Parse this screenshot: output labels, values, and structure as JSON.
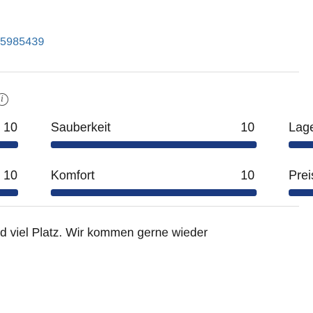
{
  "header": {
    "id_text": "5985439"
  },
  "ratings": {
    "row1": {
      "left_score": "10",
      "middle_label": "Sauberkeit",
      "middle_score": "10",
      "right_label": "Lage",
      "left_level": 1.0,
      "middle_level": 1.0,
      "right_level": 1.0
    },
    "row2": {
      "left_score": "10",
      "middle_label": "Komfort",
      "middle_score": "10",
      "right_label": "Preis",
      "left_level": 1.0,
      "middle_level": 1.0,
      "right_level": 1.0
    },
    "info_icon": "info-icon"
  },
  "review": {
    "text": "d viel Platz. Wir kommen gerne wieder"
  },
  "colors": {
    "accent_link": "#2d6ea8",
    "bar_fill": "#1a3a80",
    "bar_track": "#e6e6e6",
    "divider": "#dcdcdc"
  }
}
